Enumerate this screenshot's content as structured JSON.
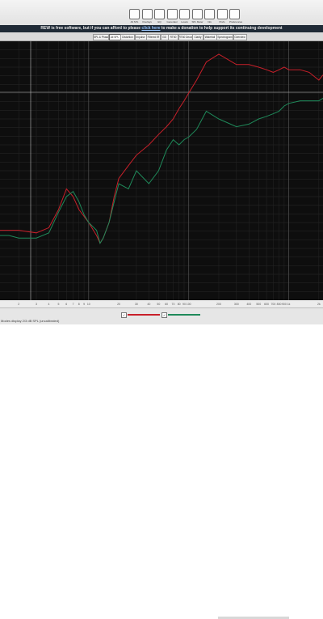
{
  "toolbar": {
    "buttons": [
      {
        "label": "All SPL",
        "icon": "all-spl-icon"
      },
      {
        "label": "Overlays",
        "icon": "overlays-icon"
      },
      {
        "label": "EQ",
        "icon": "eq-icon"
      },
      {
        "label": "Generator",
        "icon": "generator-icon"
      },
      {
        "label": "Levels",
        "icon": "levels-icon"
      },
      {
        "label": "SPL Meter",
        "icon": "spl-meter-icon"
      },
      {
        "label": "Info",
        "icon": "info-icon"
      },
      {
        "label": "Prefs",
        "icon": "prefs-icon"
      },
      {
        "label": "Preferences",
        "icon": "preferences-icon"
      }
    ]
  },
  "banner": {
    "text_before": "REW is free software, but if you can afford to please ",
    "link_text": "click here",
    "text_after": " to make a donation to help support its continuing development"
  },
  "tabs": [
    "SPL & Phase",
    "All SPL",
    "Distortion",
    "Impulse",
    "Filtered IR",
    "GD",
    "RT60",
    "RT60 Decay",
    "Clarity",
    "Waterfall",
    "Spectrogram",
    "Overview"
  ],
  "active_tab": 1,
  "x_ticks": [
    "2",
    "3",
    "4",
    "5",
    "6",
    "7",
    "8",
    "9",
    "10",
    "20",
    "30",
    "40",
    "50",
    "60",
    "70",
    "80",
    "90",
    "100",
    "200",
    "300",
    "400",
    "500",
    "600",
    "700",
    "800",
    "900",
    "1k",
    "2k"
  ],
  "status": {
    "text": "Modes display 2/3 dB SPL (uncalibrated)",
    "legend": [
      {
        "checked": "✓",
        "color": "#c8202a",
        "name": "red-trace"
      },
      {
        "checked": "✓",
        "color": "#1f8a5a",
        "name": "green-trace"
      }
    ]
  },
  "chart_data": {
    "type": "line",
    "xscale": "log",
    "xlim": [
      1.3,
      2200
    ],
    "grid": true,
    "series": [
      {
        "color": "#c8202a",
        "x": [
          1.3,
          1.6,
          2,
          3,
          4,
          5,
          6,
          7,
          8,
          10,
          12,
          13,
          14,
          16,
          18,
          20,
          25,
          30,
          40,
          50,
          60,
          70,
          80,
          90,
          100,
          120,
          150,
          200,
          300,
          400,
          500,
          600,
          700,
          800,
          900,
          1000,
          1300,
          1600,
          2000,
          2200
        ],
        "y": [
          0.27,
          0.27,
          0.27,
          0.26,
          0.28,
          0.35,
          0.43,
          0.4,
          0.35,
          0.3,
          0.25,
          0.22,
          0.24,
          0.3,
          0.4,
          0.47,
          0.52,
          0.56,
          0.6,
          0.64,
          0.67,
          0.7,
          0.74,
          0.77,
          0.8,
          0.85,
          0.92,
          0.95,
          0.91,
          0.91,
          0.9,
          0.89,
          0.88,
          0.89,
          0.9,
          0.89,
          0.89,
          0.88,
          0.85,
          0.87
        ]
      },
      {
        "color": "#1f8a5a",
        "x": [
          1.3,
          1.6,
          2,
          3,
          4,
          5,
          6,
          7,
          8,
          9,
          10,
          12,
          13,
          14,
          16,
          18,
          20,
          25,
          30,
          40,
          50,
          60,
          70,
          80,
          90,
          100,
          120,
          150,
          200,
          300,
          400,
          500,
          600,
          700,
          800,
          900,
          1000,
          1300,
          1600,
          2000,
          2200
        ],
        "y": [
          0.25,
          0.25,
          0.24,
          0.24,
          0.26,
          0.34,
          0.4,
          0.42,
          0.38,
          0.33,
          0.3,
          0.27,
          0.22,
          0.24,
          0.3,
          0.38,
          0.45,
          0.43,
          0.5,
          0.45,
          0.5,
          0.58,
          0.62,
          0.6,
          0.62,
          0.63,
          0.66,
          0.73,
          0.7,
          0.67,
          0.68,
          0.7,
          0.71,
          0.72,
          0.73,
          0.75,
          0.76,
          0.77,
          0.77,
          0.77,
          0.78
        ]
      }
    ]
  }
}
